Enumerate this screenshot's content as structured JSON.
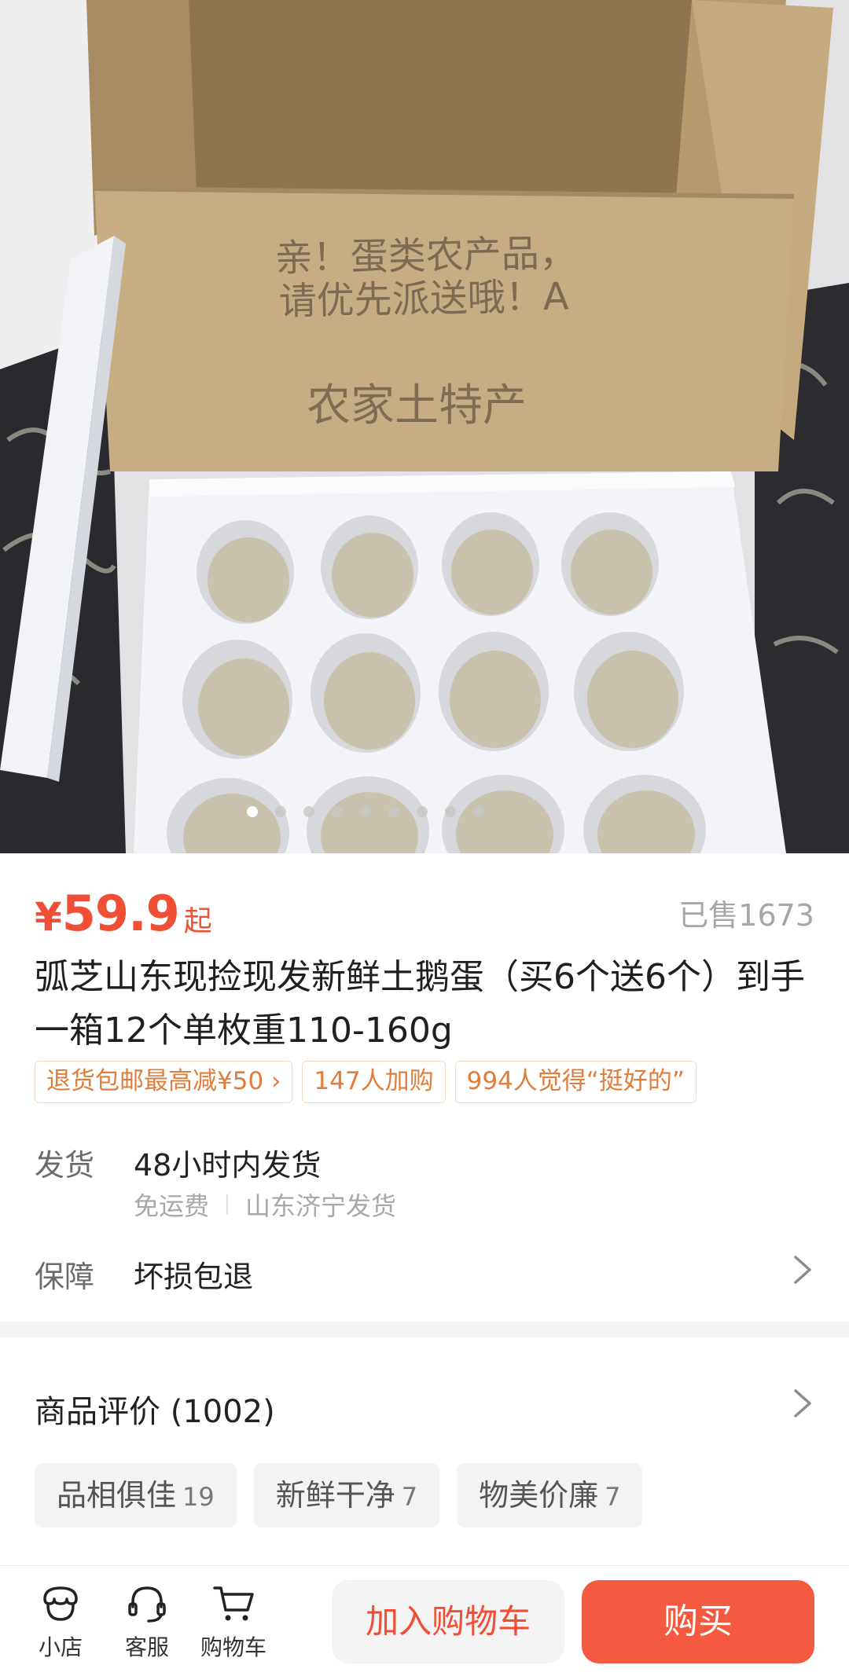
{
  "product_image": {
    "box_print_line1": "亲！蛋类农产品，",
    "box_print_line2": "请优先派送哦！A",
    "box_print_line3": "农家土特产",
    "carousel_total": 9,
    "carousel_active": 1
  },
  "price": {
    "currency": "¥",
    "value": "59.9",
    "suffix": "起"
  },
  "sold": "已售1673",
  "title": "弧芝山东现捡现发新鲜土鹅蛋（买6个送6个）到手一箱12个单枚重110-160g",
  "tags": [
    {
      "label": "退货包邮最高减¥50 ›"
    },
    {
      "label": "147人加购"
    },
    {
      "label": "994人觉得“挺好的”"
    }
  ],
  "shipping": {
    "label": "发货",
    "value": "48小时内发货",
    "fee": "免运费",
    "origin": "山东济宁发货"
  },
  "guarantee": {
    "label": "保障",
    "value": "坏损包退"
  },
  "reviews": {
    "title": "商品评价 (1002)",
    "tags": [
      {
        "label": "品相俱佳",
        "count": "19"
      },
      {
        "label": "新鲜干净",
        "count": "7"
      },
      {
        "label": "物美价廉",
        "count": "7"
      }
    ]
  },
  "bottom_bar": {
    "shop": "小店",
    "service": "客服",
    "cart": "购物车",
    "add_to_cart": "加入购物车",
    "buy": "购买"
  },
  "colors": {
    "accent": "#f04f36",
    "buy_button": "#f45a3f",
    "tag_text": "#e07d3a",
    "tag_border": "#f2dcc8"
  }
}
